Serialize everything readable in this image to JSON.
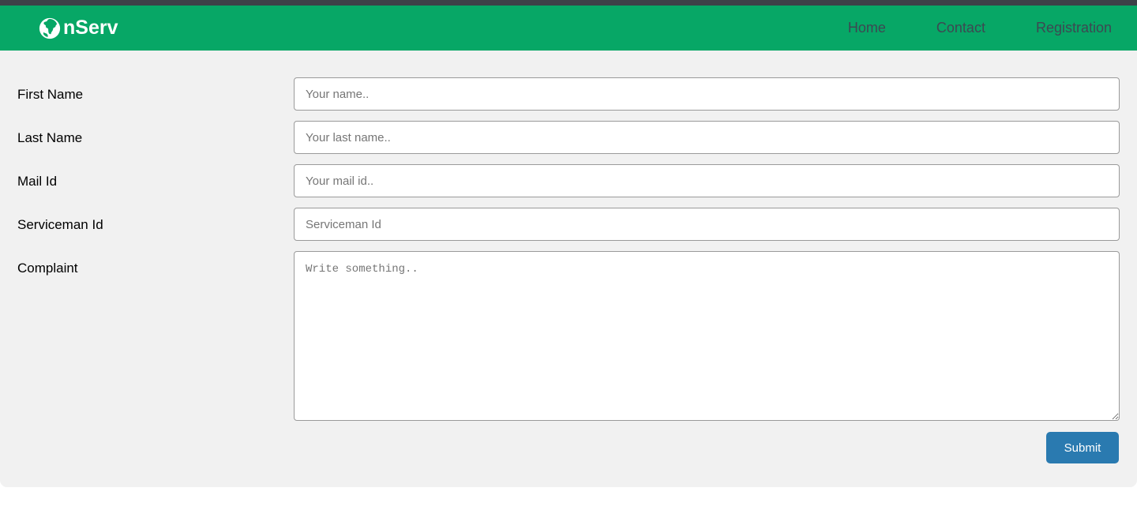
{
  "theme": {
    "top_strip_color": "#3d4148",
    "navbar_color": "#07a766",
    "nav_link_color": "#3d4852",
    "panel_bg_color": "#f1f1f1",
    "input_border_color": "#9a9a9a",
    "submit_color": "#2a7ab0",
    "page_bg_color": "#ffffff"
  },
  "navbar": {
    "brand_icon": "globe-icon",
    "brand_text": "nServ",
    "links": [
      {
        "label": "Home",
        "name": "nav-link-home"
      },
      {
        "label": "Contact",
        "name": "nav-link-contact"
      },
      {
        "label": "Registration",
        "name": "nav-link-registration"
      }
    ]
  },
  "form": {
    "fields": [
      {
        "label": "First Name",
        "placeholder": "Your name..",
        "value": "",
        "type": "text"
      },
      {
        "label": "Last Name",
        "placeholder": "Your last name..",
        "value": "",
        "type": "text"
      },
      {
        "label": "Mail Id",
        "placeholder": "Your mail id..",
        "value": "",
        "type": "text"
      },
      {
        "label": "Serviceman Id",
        "placeholder": "Serviceman Id",
        "value": "",
        "type": "text"
      },
      {
        "label": "Complaint",
        "placeholder": "Write something..",
        "value": "",
        "type": "textarea"
      }
    ],
    "submit_label": "Submit"
  }
}
